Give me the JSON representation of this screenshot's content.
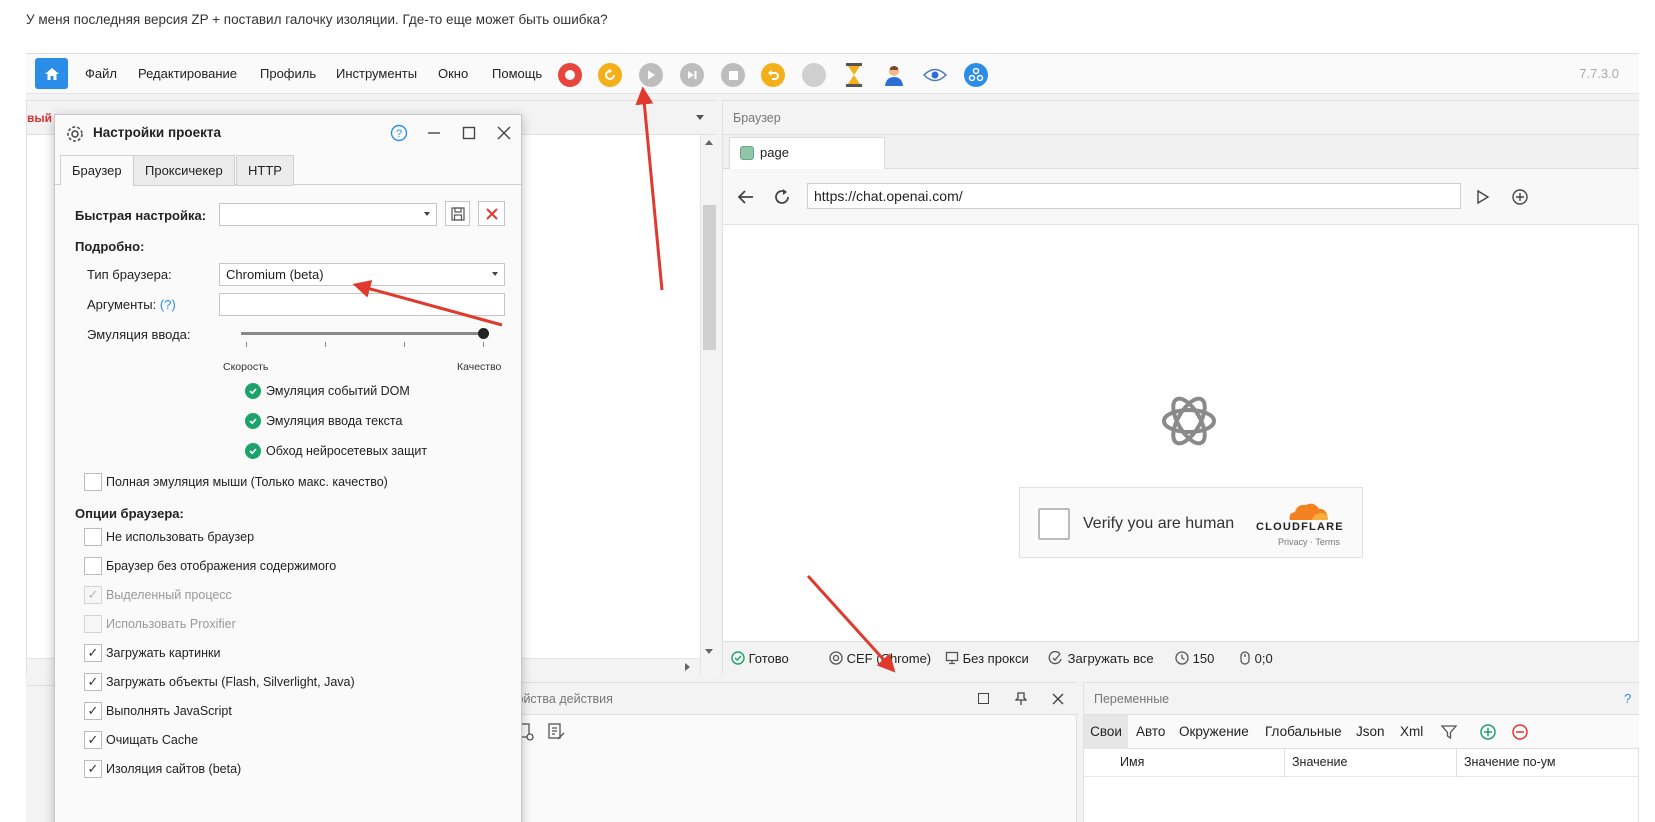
{
  "question": "У меня последняя версия ZP + поставил галочку изоляции. Где-то еще может быть ошибка?",
  "menu": {
    "items": [
      "Файл",
      "Редактирование",
      "Профиль",
      "Инструменты",
      "Окно",
      "Помощь"
    ],
    "version": "7.7.3.0"
  },
  "toolbar_icons": [
    "record-icon",
    "restart-icon",
    "play-icon",
    "step-icon",
    "stop-icon",
    "undo-icon",
    "circle-icon",
    "hourglass-icon",
    "user-icon",
    "eye-icon",
    "network-icon"
  ],
  "left_panel": {
    "fragment": "вый"
  },
  "browser": {
    "header": "Браузер",
    "tab": "page",
    "url": "https://chat.openai.com/",
    "captcha_text": "Verify you are human",
    "cloudflare_brand": "CLOUDFLARE",
    "privacy_terms": "Privacy · Terms",
    "status": {
      "ready": "Готово",
      "engine": "CEF (Chrome)",
      "proxy": "Без прокси",
      "load": "Загружать все",
      "timeout": "150",
      "mouse": "0;0"
    }
  },
  "props_panel": {
    "title": "войства действия"
  },
  "vars_panel": {
    "title": "Переменные",
    "help": "?",
    "tabs": [
      "Свои",
      "Авто",
      "Окружение",
      "Глобальные",
      "Json",
      "Xml"
    ],
    "columns": [
      "Имя",
      "Значение",
      "Значение по-ум"
    ]
  },
  "dialog": {
    "title": "Настройки проекта",
    "tabs": [
      "Браузер",
      "Проксичекер",
      "HTTP"
    ],
    "quick_label": "Быстрая настройка:",
    "quick_value": "",
    "details_label": "Подробно:",
    "browser_type_label": "Тип браузера:",
    "browser_type_value": "Chromium (beta)",
    "args_label": "Аргументы:",
    "args_help": "(?)",
    "args_value": "",
    "emulation_label": "Эмуляция ввода:",
    "slider_level": 1.0,
    "slider_left": "Скорость",
    "slider_right": "Качество",
    "green_checks": [
      "Эмуляция событий DOM",
      "Эмуляция ввода текста",
      "Обход нейросетевых защит"
    ],
    "full_mouse": "Полная эмуляция мыши (Только макс. качество)",
    "options_label": "Опции браузера:",
    "options": [
      {
        "label": "Не использовать браузер",
        "checked": false,
        "disabled": false
      },
      {
        "label": "Браузер без отображения содержимого",
        "checked": false,
        "disabled": false
      },
      {
        "label": "Выделенный процесс",
        "checked": true,
        "disabled": true
      },
      {
        "label": "Использовать Proxifier",
        "checked": false,
        "disabled": true
      },
      {
        "label": "Загружать картинки",
        "checked": true,
        "disabled": false
      },
      {
        "label": "Загружать объекты (Flash, Silverlight, Java)",
        "checked": true,
        "disabled": false
      },
      {
        "label": "Выполнять JavaScript",
        "checked": true,
        "disabled": false
      },
      {
        "label": "Очищать Cache",
        "checked": true,
        "disabled": false
      },
      {
        "label": "Изоляция сайтов (beta)",
        "checked": true,
        "disabled": false
      }
    ]
  },
  "colors": {
    "accent": "#2a8ee8",
    "arrow": "#e03a2e",
    "record": "#e8453c",
    "restart": "#f4b01a",
    "gray_btn": "#bdbdbd",
    "check_green": "#1ca36b"
  }
}
